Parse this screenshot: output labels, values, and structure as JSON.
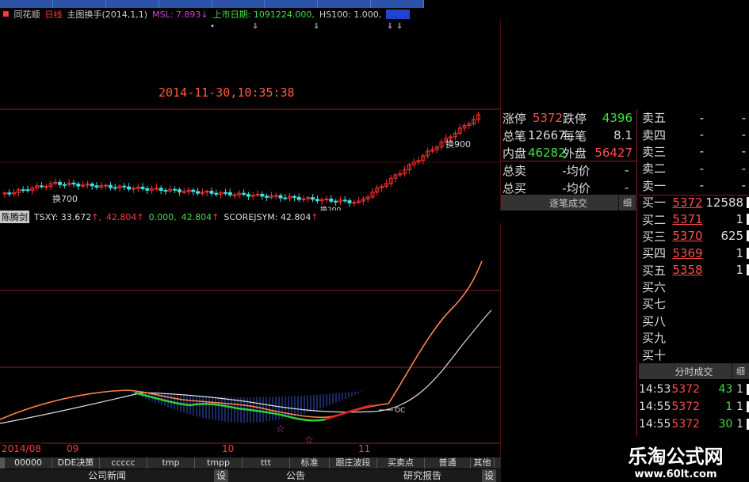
{
  "tabs": [
    "",
    "",
    "",
    "",
    "",
    "",
    "",
    ""
  ],
  "header": {
    "app": "同花顺",
    "period": "日线",
    "indicator": "主图换手",
    "params": "(2014,1,1)",
    "msl_label": "MSL:",
    "msl_value": "7.893",
    "listing_label": "上市日期:",
    "listing_value": "1091224.000,",
    "hs_label": "HS100:",
    "hs_value": "1.000,",
    "color_main": "#e8e8e8",
    "color_red": "#ff3a3a",
    "color_magenta": "#d040d0",
    "color_green": "#40e040",
    "color_label_bg": "#c8c8c8"
  },
  "datetime": "2014-11-30,10:35:38",
  "annotations": {
    "huan700": "换700",
    "huan900": "换900",
    "low": "换200"
  },
  "indicator_line": {
    "name": "陈腾剑",
    "tsxy_label": "TSXY:",
    "tsxy_value": "33.672",
    "v2": "42.804",
    "v3": "0.000,",
    "v4": "42.804",
    "score_label": "SCOREJSYM:",
    "score_value": "42.804"
  },
  "date_axis": {
    "d1": "2014/08",
    "d2": "09",
    "d3": "10",
    "d4": "11"
  },
  "bottom_buttons": [
    "00000",
    "DDE决策",
    "ccccc",
    "tmp",
    "tmpp",
    "ttt",
    "标准",
    "跟庄波段",
    "买卖点",
    "普通",
    "其他"
  ],
  "bottom_links": {
    "news": "公司新闻",
    "notice": "公告",
    "research": "研究报告",
    "set": "设"
  },
  "quote": {
    "zt_label": "涨停",
    "zt_value": "5372",
    "dt_label": "跌停",
    "dt_value": "4396",
    "zb_label": "总笔",
    "zb_value": "12667",
    "mb_label": "每笔",
    "mb_value": "8.1",
    "np_label": "内盘",
    "np_value": "46282",
    "wp_label": "外盘",
    "wp_value": "56427",
    "zm_label": "总卖",
    "zm_value": "-均价",
    "zm_tail": "-",
    "zb2_label": "总买",
    "zb2_value": "-均价",
    "zb2_tail": "-"
  },
  "panel_tabs": {
    "zbcj": "逐笔成交",
    "xi": "细",
    "fscj": "分时成交"
  },
  "book": [
    {
      "label": "卖五",
      "price": "-",
      "qty": "-"
    },
    {
      "label": "卖四",
      "price": "-",
      "qty": "-"
    },
    {
      "label": "卖三",
      "price": "-",
      "qty": "-"
    },
    {
      "label": "卖二",
      "price": "-",
      "qty": "-"
    },
    {
      "label": "卖一",
      "price": "-",
      "qty": "-"
    },
    {
      "label": "买一",
      "price": "5372",
      "qty": "12588"
    },
    {
      "label": "买二",
      "price": "5371",
      "qty": "1"
    },
    {
      "label": "买三",
      "price": "5370",
      "qty": "625"
    },
    {
      "label": "买四",
      "price": "5369",
      "qty": "1"
    },
    {
      "label": "买五",
      "price": "5358",
      "qty": "1"
    },
    {
      "label": "买六",
      "price": "",
      "qty": ""
    },
    {
      "label": "买七",
      "price": "",
      "qty": ""
    },
    {
      "label": "买八",
      "price": "",
      "qty": ""
    },
    {
      "label": "买九",
      "price": "",
      "qty": ""
    },
    {
      "label": "买十",
      "price": "",
      "qty": ""
    }
  ],
  "trades": [
    {
      "time": "14:53",
      "price": "5372",
      "qty": "43",
      "flag": "1"
    },
    {
      "time": "14:55",
      "price": "5372",
      "qty": "1",
      "flag": "1"
    },
    {
      "time": "14:55",
      "price": "5372",
      "qty": "30",
      "flag": "1"
    }
  ],
  "watermark": {
    "title": "乐淘公式网",
    "url": "www.60lt.com"
  },
  "oc_label": "OC"
}
